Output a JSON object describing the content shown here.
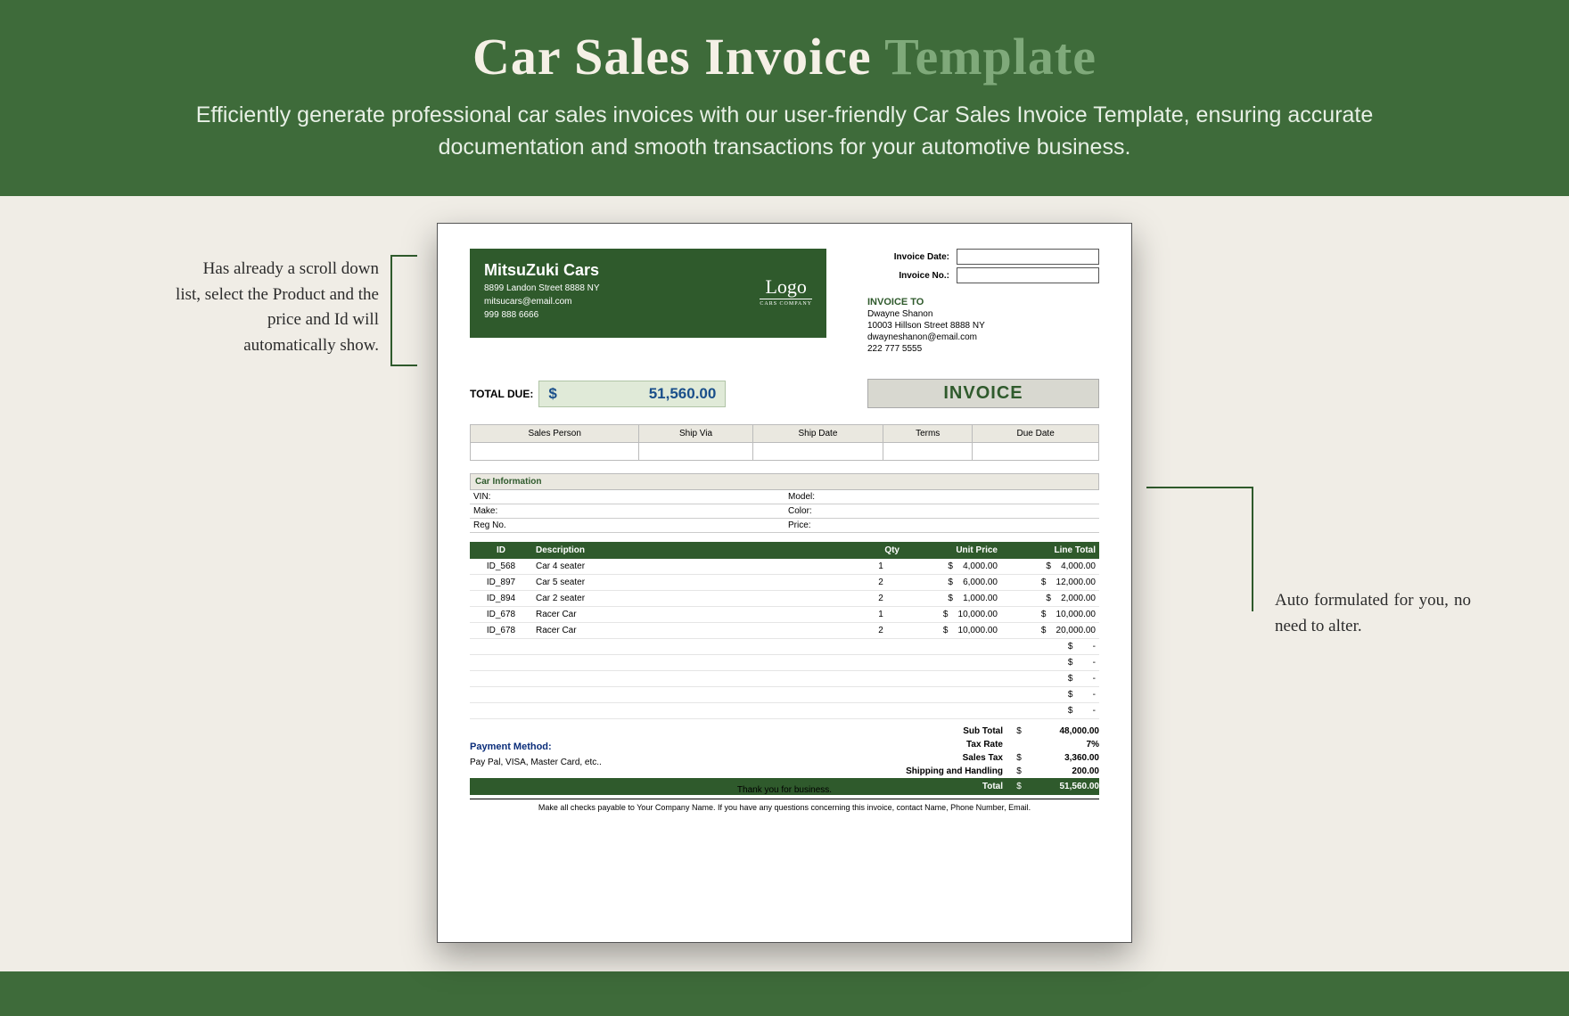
{
  "hero": {
    "title_a": "Car Sales Invoice",
    "title_b": "Template",
    "subtitle": "Efficiently generate professional car sales invoices with our user-friendly Car Sales Invoice Template, ensuring accurate documentation and smooth transactions for your automotive business."
  },
  "annotations": {
    "left": "Has already a scroll down list, select the Product and the price and Id will automatically show.",
    "right": "Auto formulated for you, no need to alter."
  },
  "company": {
    "name": "MitsuZuki Cars",
    "address": "8899 Landon Street 8888 NY",
    "email": "mitsucars@email.com",
    "phone": "999 888 6666",
    "logo_big": "Logo",
    "logo_small": "CARS COMPANY"
  },
  "meta": {
    "date_label": "Invoice Date:",
    "no_label": "Invoice No.:"
  },
  "invoice_to": {
    "heading": "INVOICE TO",
    "name": "Dwayne Shanon",
    "address": "10003 Hillson Street 8888 NY",
    "email": "dwayneshanon@email.com",
    "phone": "222 777 5555"
  },
  "total_due": {
    "label": "TOTAL DUE:",
    "currency": "$",
    "value": "51,560.00"
  },
  "badge": "INVOICE",
  "ship_headers": {
    "sales": "Sales Person",
    "via": "Ship Via",
    "date": "Ship Date",
    "terms": "Terms",
    "due": "Due Date"
  },
  "car": {
    "heading": "Car Information",
    "vin": "VIN:",
    "model": "Model:",
    "make": "Make:",
    "color": "Color:",
    "reg": "Reg No.",
    "price": "Price:"
  },
  "items_headers": {
    "id": "ID",
    "desc": "Description",
    "qty": "Qty",
    "unit": "Unit Price",
    "line": "Line Total"
  },
  "items": [
    {
      "id": "ID_568",
      "desc": "Car 4 seater",
      "qty": "1",
      "unit": "4,000.00",
      "line": "4,000.00"
    },
    {
      "id": "ID_897",
      "desc": "Car 5 seater",
      "qty": "2",
      "unit": "6,000.00",
      "line": "12,000.00"
    },
    {
      "id": "ID_894",
      "desc": "Car 2 seater",
      "qty": "2",
      "unit": "1,000.00",
      "line": "2,000.00"
    },
    {
      "id": "ID_678",
      "desc": "Racer Car",
      "qty": "1",
      "unit": "10,000.00",
      "line": "10,000.00"
    },
    {
      "id": "ID_678",
      "desc": "Racer Car",
      "qty": "2",
      "unit": "10,000.00",
      "line": "20,000.00"
    }
  ],
  "empty_dash": "-",
  "summary": {
    "subtotal_l": "Sub Total",
    "subtotal": "48,000.00",
    "taxrate_l": "Tax Rate",
    "taxrate": "7%",
    "salestax_l": "Sales Tax",
    "salestax": "3,360.00",
    "ship_l": "Shipping and Handling",
    "ship": "200.00",
    "total_l": "Total",
    "total": "51,560.00",
    "currency": "$"
  },
  "payment": {
    "heading": "Payment Method:",
    "text": "Pay Pal, VISA, Master Card, etc.."
  },
  "thankyou": "Thank you for business.",
  "footnote": "Make all checks payable to Your Company Name. If you have any questions concerning this invoice, contact Name, Phone Number, Email."
}
